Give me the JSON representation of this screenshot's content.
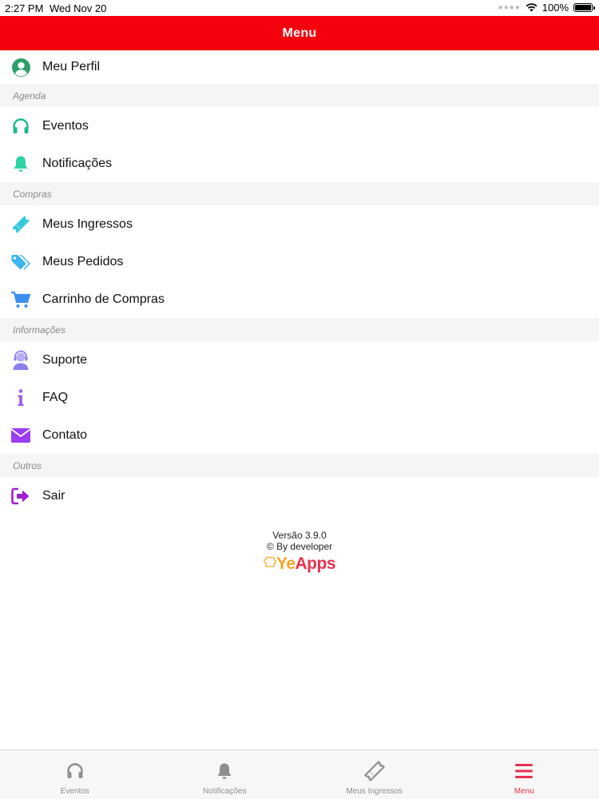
{
  "status_bar": {
    "time": "2:27 PM",
    "date": "Wed Nov 20",
    "battery": "100%"
  },
  "header": {
    "title": "Menu"
  },
  "menu": {
    "profile": {
      "label": "Meu Perfil",
      "icon": "user-circle-icon",
      "color": "#2e9e6a"
    },
    "sections": [
      {
        "title": "Agenda",
        "items": [
          {
            "label": "Eventos",
            "icon": "headphones-icon",
            "color": "#22b98a"
          },
          {
            "label": "Notificações",
            "icon": "bell-icon",
            "color": "#2fd4a6"
          }
        ]
      },
      {
        "title": "Compras",
        "items": [
          {
            "label": "Meus Ingressos",
            "icon": "ticket-icon",
            "color": "#38c9e0"
          },
          {
            "label": "Meus Pedidos",
            "icon": "tags-icon",
            "color": "#3bb5ee"
          },
          {
            "label": "Carrinho de Compras",
            "icon": "cart-icon",
            "color": "#3b8ff0"
          }
        ]
      },
      {
        "title": "Informações",
        "items": [
          {
            "label": "Suporte",
            "icon": "support-agent-icon",
            "color": "#8a7ef0"
          },
          {
            "label": "FAQ",
            "icon": "info-icon",
            "color": "#9a5cf0"
          },
          {
            "label": "Contato",
            "icon": "envelope-icon",
            "color": "#9a3cf0"
          }
        ]
      },
      {
        "title": "Outros",
        "items": [
          {
            "label": "Sair",
            "icon": "sign-out-icon",
            "color": "#a020d0"
          }
        ]
      }
    ]
  },
  "about": {
    "version": "Versão 3.9.0",
    "credit": "© By developer",
    "logo_ye": "Ye",
    "logo_apps": "Apps"
  },
  "tabbar": {
    "tabs": [
      {
        "label": "Eventos",
        "icon": "headphones-icon",
        "active": false
      },
      {
        "label": "Notificações",
        "icon": "bell-icon",
        "active": false
      },
      {
        "label": "Meus Ingressos",
        "icon": "ticket-icon",
        "active": false
      },
      {
        "label": "Menu",
        "icon": "hamburger-menu-icon",
        "active": true
      }
    ],
    "active_color": "#e8304f",
    "inactive_color": "#8e8e8e"
  },
  "colors": {
    "header_bg": "#f5000d",
    "section_bg": "#f5f5f5"
  }
}
